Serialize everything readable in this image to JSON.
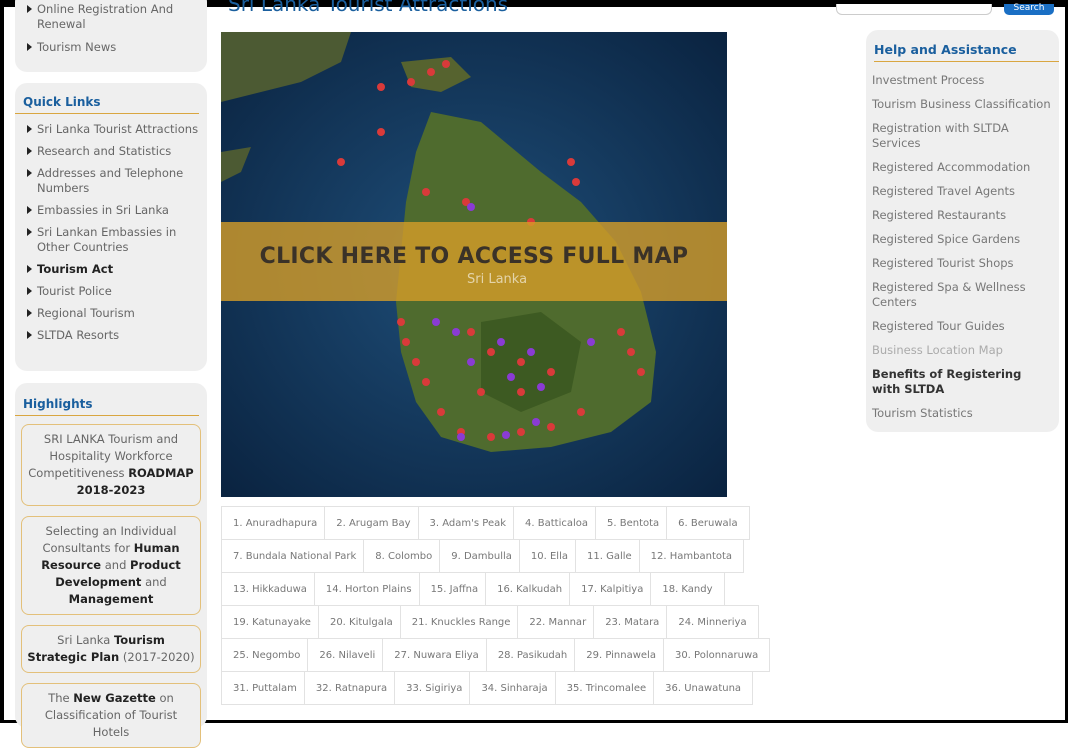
{
  "left_top": {
    "items": [
      "Online Registration And Renewal",
      "Tourism News"
    ]
  },
  "quick_links": {
    "title": "Quick Links",
    "items": [
      {
        "label": "Sri Lanka Tourist Attractions",
        "bold": false
      },
      {
        "label": "Research and Statistics",
        "bold": false
      },
      {
        "label": "Addresses and Telephone Numbers",
        "bold": false
      },
      {
        "label": "Embassies in Sri Lanka",
        "bold": false
      },
      {
        "label": "Sri Lankan Embassies in Other Countries",
        "bold": false
      },
      {
        "label": "Tourism Act",
        "bold": true
      },
      {
        "label": "Tourist Police",
        "bold": false
      },
      {
        "label": "Regional Tourism",
        "bold": false
      },
      {
        "label": "SLTDA Resorts",
        "bold": false
      }
    ]
  },
  "highlights": {
    "title": "Highlights",
    "boxes": [
      {
        "pre": "SRI LANKA Tourism and Hospitality Workforce Competitiveness ",
        "b1": "ROADMAP 2018-2023",
        "mid": "",
        "b2": "",
        "post": "",
        "b3": ""
      },
      {
        "pre": "Selecting an Individual Consultants for ",
        "b1": "Human Resource",
        "mid": " and ",
        "b2": "Product Development",
        "post": " and ",
        "b3": "Management"
      },
      {
        "pre": "Sri Lanka ",
        "b1": "Tourism Strategic Plan",
        "mid": " (2017-2020)",
        "b2": "",
        "post": "",
        "b3": ""
      },
      {
        "pre": "The ",
        "b1": "New Gazette",
        "mid": " on Classification of Tourist Hotels",
        "b2": "",
        "post": "",
        "b3": ""
      }
    ]
  },
  "header": {
    "title": "Sri Lanka Tourist Attractions",
    "search_button": "Search"
  },
  "map": {
    "banner": "CLICK HERE TO ACCESS FULL MAP",
    "country_label": "Sri Lanka"
  },
  "places": [
    "1. Anuradhapura",
    "2. Arugam Bay",
    "3. Adam's Peak",
    "4. Batticaloa",
    "5. Bentota",
    "6. Beruwala",
    "7. Bundala National Park",
    "8. Colombo",
    "9. Dambulla",
    "10. Ella",
    "11. Galle",
    "12. Hambantota",
    "13. Hikkaduwa",
    "14. Horton Plains",
    "15. Jaffna",
    "16. Kalkudah",
    "17. Kalpitiya",
    "18. Kandy",
    "19. Katunayake",
    "20. Kitulgala",
    "21. Knuckles Range",
    "22. Mannar",
    "23. Matara",
    "24. Minneriya",
    "25. Negombo",
    "26. Nilaveli",
    "27. Nuwara Eliya",
    "28. Pasikudah",
    "29. Pinnawela",
    "30. Polonnaruwa",
    "31. Puttalam",
    "32. Ratnapura",
    "33. Sigiriya",
    "34. Sinharaja",
    "35. Trincomalee",
    "36. Unawatuna"
  ],
  "help": {
    "title": "Help and Assistance",
    "items": [
      {
        "label": "Investment Process",
        "style": "normal"
      },
      {
        "label": "Tourism Business Classification",
        "style": "normal"
      },
      {
        "label": "Registration with SLTDA Services",
        "style": "normal"
      },
      {
        "label": "Registered Accommodation",
        "style": "normal"
      },
      {
        "label": "Registered Travel Agents",
        "style": "normal"
      },
      {
        "label": "Registered Restaurants",
        "style": "normal"
      },
      {
        "label": "Registered Spice Gardens",
        "style": "normal"
      },
      {
        "label": "Registered Tourist Shops",
        "style": "normal"
      },
      {
        "label": "Registered Spa & Wellness Centers",
        "style": "normal"
      },
      {
        "label": "Registered Tour Guides",
        "style": "normal"
      },
      {
        "label": "Business Location Map",
        "style": "dim"
      },
      {
        "label": "Benefits of Registering with SLTDA",
        "style": "bold"
      },
      {
        "label": "Tourism Statistics",
        "style": "normal"
      }
    ]
  }
}
